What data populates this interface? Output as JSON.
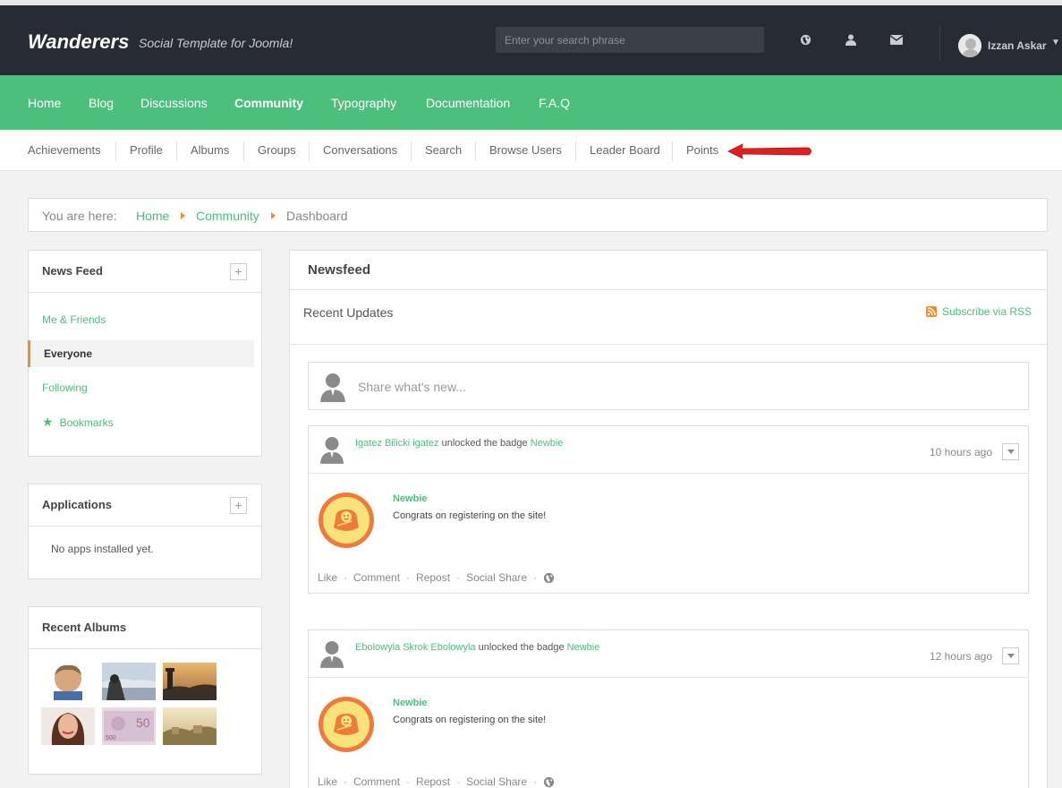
{
  "header": {
    "brand": "Wanderers",
    "tagline": "Social Template for Joomla!",
    "search_placeholder": "Enter your search phrase",
    "user_name": "Izzan Askar"
  },
  "main_nav": [
    "Home",
    "Blog",
    "Discussions",
    "Community",
    "Typography",
    "Documentation",
    "F.A.Q"
  ],
  "main_nav_active": "Community",
  "sub_nav": [
    "Achievements",
    "Profile",
    "Albums",
    "Groups",
    "Conversations",
    "Search",
    "Browse Users",
    "Leader Board",
    "Points"
  ],
  "breadcrumb": {
    "label": "You are here:",
    "items": [
      "Home",
      "Community",
      "Dashboard"
    ]
  },
  "sidebar": {
    "news_feed": {
      "title": "News Feed",
      "plus": "+",
      "items": [
        "Me & Friends",
        "Everyone",
        "Following",
        "Bookmarks"
      ],
      "active": "Everyone"
    },
    "applications": {
      "title": "Applications",
      "plus": "+",
      "empty_text": "No apps installed yet."
    },
    "recent_albums": {
      "title": "Recent Albums"
    }
  },
  "newsfeed": {
    "title": "Newsfeed",
    "subtitle": "Recent Updates",
    "rss_label": "Subscribe via RSS",
    "share_placeholder": "Share what's new...",
    "posts": [
      {
        "user": "Igatez Bilicki igatez",
        "action": "unlocked the badge",
        "badge_link": "Newbie",
        "time": "10 hours ago",
        "badge_title": "Newbie",
        "badge_desc": "Congrats on registering on the site!",
        "actions": [
          "Like",
          "Comment",
          "Repost",
          "Social Share"
        ]
      },
      {
        "user": "Ebolowyla Skrok Ebolowyla",
        "action": "unlocked the badge",
        "badge_link": "Newbie",
        "time": "12 hours ago",
        "badge_title": "Newbie",
        "badge_desc": "Congrats on registering on the site!",
        "actions": [
          "Like",
          "Comment",
          "Repost",
          "Social Share"
        ]
      }
    ]
  },
  "colors": {
    "accent": "#4bbf7b",
    "topbar": "#272b33",
    "orange": "#e8912d",
    "arrow": "#e02020"
  }
}
